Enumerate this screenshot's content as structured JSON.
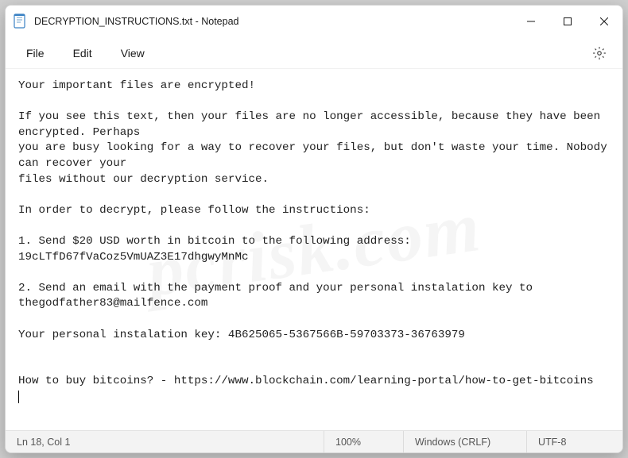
{
  "titlebar": {
    "filename": "DECRYPTION_INSTRUCTIONS.txt",
    "appname": "Notepad"
  },
  "menubar": {
    "items": [
      "File",
      "Edit",
      "View"
    ]
  },
  "content": {
    "text": "Your important files are encrypted!\n\nIf you see this text, then your files are no longer accessible, because they have been encrypted. Perhaps\nyou are busy looking for a way to recover your files, but don't waste your time. Nobody can recover your\nfiles without our decryption service.\n\nIn order to decrypt, please follow the instructions:\n\n1. Send $20 USD worth in bitcoin to the following address: 19cLTfD67fVaCoz5VmUAZ3E17dhgwyMnMc\n\n2. Send an email with the payment proof and your personal instalation key to thegodfather83@mailfence.com\n\nYour personal instalation key: 4B625065-5367566B-59703373-36763979\n\n\nHow to buy bitcoins? - https://www.blockchain.com/learning-portal/how-to-get-bitcoins"
  },
  "statusbar": {
    "cursor": "Ln 18, Col 1",
    "zoom": "100%",
    "line_ending": "Windows (CRLF)",
    "encoding": "UTF-8"
  },
  "watermark": "pcrisk.com"
}
